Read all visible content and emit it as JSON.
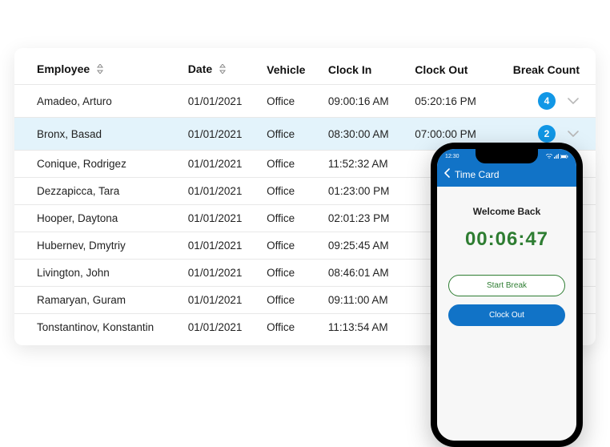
{
  "table": {
    "headers": {
      "employee": "Employee",
      "date": "Date",
      "vehicle": "Vehicle",
      "clock_in": "Clock In",
      "clock_out": "Clock Out",
      "break_count": "Break Count"
    },
    "rows": [
      {
        "employee": "Amadeo, Arturo",
        "date": "01/01/2021",
        "vehicle": "Office",
        "clock_in": "09:00:16 AM",
        "clock_out": "05:20:16 PM",
        "break_count": "4",
        "highlight": false
      },
      {
        "employee": "Bronx, Basad",
        "date": "01/01/2021",
        "vehicle": "Office",
        "clock_in": "08:30:00 AM",
        "clock_out": "07:00:00 PM",
        "break_count": "2",
        "highlight": true
      },
      {
        "employee": "Conique, Rodrigez",
        "date": "01/01/2021",
        "vehicle": "Office",
        "clock_in": "11:52:32 AM",
        "clock_out": "",
        "break_count": "",
        "highlight": false
      },
      {
        "employee": "Dezzapicca, Tara",
        "date": "01/01/2021",
        "vehicle": "Office",
        "clock_in": "01:23:00 PM",
        "clock_out": "",
        "break_count": "",
        "highlight": false
      },
      {
        "employee": "Hooper, Daytona",
        "date": "01/01/2021",
        "vehicle": "Office",
        "clock_in": "02:01:23 PM",
        "clock_out": "",
        "break_count": "",
        "highlight": false
      },
      {
        "employee": "Hubernev, Dmytriy",
        "date": "01/01/2021",
        "vehicle": "Office",
        "clock_in": "09:25:45 AM",
        "clock_out": "",
        "break_count": "",
        "highlight": false
      },
      {
        "employee": "Livington, John",
        "date": "01/01/2021",
        "vehicle": "Office",
        "clock_in": "08:46:01 AM",
        "clock_out": "",
        "break_count": "",
        "highlight": false
      },
      {
        "employee": "Ramaryan, Guram",
        "date": "01/01/2021",
        "vehicle": "Office",
        "clock_in": "09:11:00 AM",
        "clock_out": "",
        "break_count": "",
        "highlight": false
      },
      {
        "employee": "Tonstantinov, Konstantin",
        "date": "01/01/2021",
        "vehicle": "Office",
        "clock_in": "11:13:54 AM",
        "clock_out": "",
        "break_count": "",
        "highlight": false
      }
    ]
  },
  "phone": {
    "status_time": "12:30",
    "header_title": "Time Card",
    "welcome": "Welcome Back",
    "timer": "00:06:47",
    "start_break": "Start Break",
    "clock_out": "Clock Out"
  },
  "colors": {
    "accent_blue": "#1173c7",
    "badge_blue": "#1197e6",
    "timer_green": "#2e7d32",
    "row_highlight": "#e3f3fb"
  }
}
